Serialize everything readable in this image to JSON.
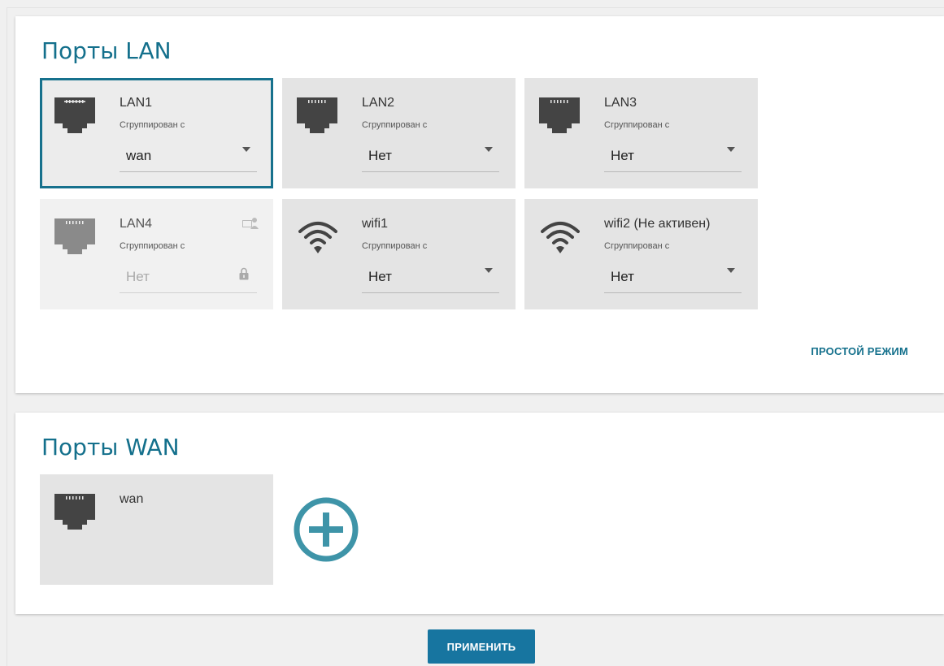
{
  "lan_section": {
    "title": "Порты LAN",
    "simple_mode_label": "ПРОСТОЙ РЕЖИМ",
    "ports": [
      {
        "name": "LAN1",
        "grouped_label": "Сгруппирован с",
        "value": "wan",
        "icon": "ethernet-port-icon",
        "state": "selected"
      },
      {
        "name": "LAN2",
        "grouped_label": "Сгруппирован с",
        "value": "Нет",
        "icon": "ethernet-port-icon",
        "state": "normal"
      },
      {
        "name": "LAN3",
        "grouped_label": "Сгруппирован с",
        "value": "Нет",
        "icon": "ethernet-port-icon",
        "state": "normal"
      },
      {
        "name": "LAN4",
        "grouped_label": "Сгруппирован с",
        "value": "Нет",
        "icon": "ethernet-port-icon",
        "state": "disabled"
      },
      {
        "name": "wifi1",
        "grouped_label": "Сгруппирован с",
        "value": "Нет",
        "icon": "wifi-icon",
        "state": "normal"
      },
      {
        "name": "wifi2 (Не активен)",
        "grouped_label": "Сгруппирован с",
        "value": "Нет",
        "icon": "wifi-icon",
        "state": "normal"
      }
    ]
  },
  "wan_section": {
    "title": "Порты WAN",
    "ports": [
      {
        "name": "wan",
        "icon": "ethernet-port-icon"
      }
    ],
    "add_icon": "plus-circle-icon"
  },
  "footer": {
    "apply_label": "ПРИМЕНИТЬ"
  },
  "colors": {
    "accent": "#14708c",
    "button": "#1775a0",
    "icon_dark": "#444444",
    "icon_disabled": "#8a8a8a",
    "add_icon": "#3e94a8"
  }
}
